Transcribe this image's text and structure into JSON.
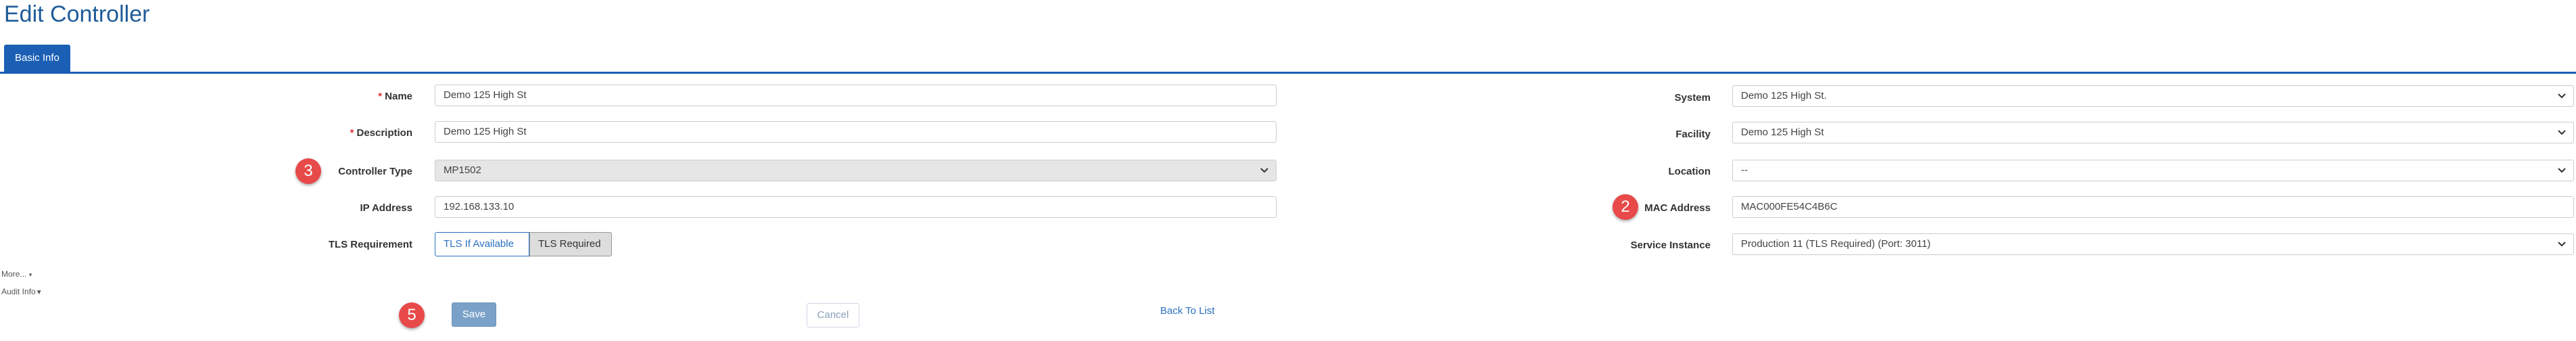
{
  "page": {
    "title": "Edit Controller"
  },
  "tabs": [
    {
      "label": "Basic Info"
    }
  ],
  "form": {
    "name": {
      "label": "Name",
      "value": "Demo 125 High St"
    },
    "description": {
      "label": "Description",
      "value": "Demo 125 High St"
    },
    "controller_type": {
      "label": "Controller Type",
      "value": "MP1502"
    },
    "ip_address": {
      "label": "IP Address",
      "value": "192.168.133.10"
    },
    "tls_requirement": {
      "label": "TLS Requirement",
      "options": [
        "TLS If Available",
        "TLS Required"
      ],
      "selected": "TLS If Available"
    },
    "system": {
      "label": "System",
      "value": "Demo 125 High St."
    },
    "facility": {
      "label": "Facility",
      "value": "Demo 125 High St"
    },
    "location": {
      "label": "Location",
      "value": "--"
    },
    "mac_address": {
      "label": "MAC Address",
      "value": "MAC000FE54C4B6C"
    },
    "service_instance": {
      "label": "Service Instance",
      "value": "Production 11 (TLS Required) (Port: 3011)"
    }
  },
  "more_link": {
    "label": "More..."
  },
  "audit_link": {
    "label": "Audit Info"
  },
  "actions": {
    "save": "Save",
    "cancel": "Cancel",
    "back": "Back To List"
  },
  "badges": {
    "controller_type": "3",
    "mac_address": "2",
    "save": "5"
  },
  "colors": {
    "primary": "#1a5fb4",
    "badge": "#e84a4a",
    "required": "#e03030"
  }
}
